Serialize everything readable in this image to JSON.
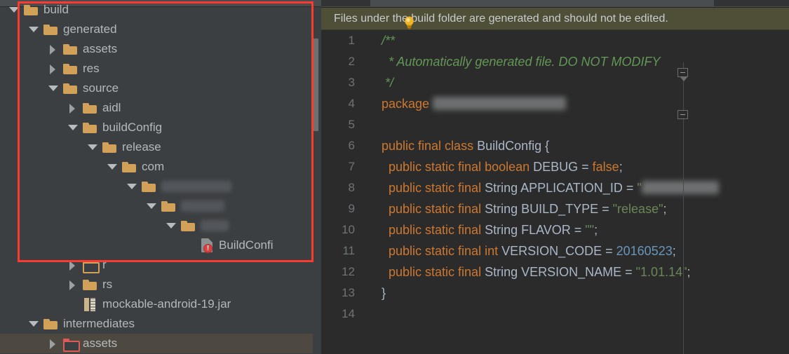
{
  "window": {
    "theme": "darcula",
    "accent_annotation_color": "#fb3b30",
    "panel_bg": "#3c3f41",
    "editor_bg": "#2b2b2b",
    "banner_bg": "#4f4f38",
    "selection_bg": "#4e4940"
  },
  "tree": {
    "panel_name": "Project tool window",
    "scroll_thumb_visible": true,
    "items": [
      {
        "label": "build",
        "depth": 0,
        "state": "expanded",
        "icon": "folder-icon",
        "selected": false,
        "redacted": false
      },
      {
        "label": "generated",
        "depth": 1,
        "state": "expanded",
        "icon": "folder-icon",
        "selected": false,
        "redacted": false
      },
      {
        "label": "assets",
        "depth": 2,
        "state": "collapsed",
        "icon": "folder-icon",
        "selected": false,
        "redacted": false
      },
      {
        "label": "res",
        "depth": 2,
        "state": "collapsed",
        "icon": "folder-icon",
        "selected": false,
        "redacted": false
      },
      {
        "label": "source",
        "depth": 2,
        "state": "expanded",
        "icon": "folder-icon",
        "selected": false,
        "redacted": false
      },
      {
        "label": "aidl",
        "depth": 3,
        "state": "collapsed",
        "icon": "folder-icon",
        "selected": false,
        "redacted": false
      },
      {
        "label": "buildConfig",
        "depth": 3,
        "state": "expanded",
        "icon": "folder-icon",
        "selected": false,
        "redacted": false
      },
      {
        "label": "release",
        "depth": 4,
        "state": "expanded",
        "icon": "folder-icon",
        "selected": false,
        "redacted": false
      },
      {
        "label": "com",
        "depth": 5,
        "state": "expanded",
        "icon": "folder-icon",
        "selected": false,
        "redacted": false
      },
      {
        "label": "",
        "depth": 6,
        "state": "expanded",
        "icon": "folder-icon",
        "selected": false,
        "redacted": true,
        "redact_width": 100
      },
      {
        "label": "",
        "depth": 7,
        "state": "expanded",
        "icon": "folder-icon",
        "selected": false,
        "redacted": true,
        "redact_width": 62
      },
      {
        "label": "",
        "depth": 8,
        "state": "expanded",
        "icon": "folder-icon",
        "selected": false,
        "redacted": true,
        "redact_width": 40
      },
      {
        "label": "BuildConfi",
        "depth": 9,
        "state": "none",
        "icon": "java-file-error-icon",
        "selected": false,
        "redacted": false
      },
      {
        "label": "r",
        "depth": 3,
        "state": "collapsed",
        "icon": "folder-open-icon",
        "selected": false,
        "redacted": false
      },
      {
        "label": "rs",
        "depth": 3,
        "state": "collapsed",
        "icon": "folder-icon",
        "selected": false,
        "redacted": false
      },
      {
        "label": "mockable-android-19.jar",
        "depth": 3,
        "state": "none",
        "icon": "jar-archive-icon",
        "selected": false,
        "redacted": false
      },
      {
        "label": "intermediates",
        "depth": 1,
        "state": "expanded",
        "icon": "folder-icon",
        "selected": false,
        "redacted": false
      },
      {
        "label": "assets",
        "depth": 2,
        "state": "collapsed",
        "icon": "folder-red-icon",
        "selected": true,
        "redacted": false
      }
    ]
  },
  "editor": {
    "banner": {
      "text": "Files under the build folder are generated and should not be edited.",
      "icon": "lightbulb-icon"
    },
    "line_numbers": [
      "1",
      "2",
      "3",
      "4",
      "5",
      "6",
      "7",
      "8",
      "9",
      "10",
      "11",
      "12",
      "13",
      "14"
    ],
    "lines": [
      {
        "n": "1",
        "fold": "start",
        "tokens": [
          {
            "t": "/**",
            "c": "cmt"
          }
        ]
      },
      {
        "n": "2",
        "fold": "",
        "tokens": [
          {
            "t": "  * Automatically generated file. DO NOT MODIFY",
            "c": "cmt"
          }
        ]
      },
      {
        "n": "3",
        "fold": "end",
        "tokens": [
          {
            "t": " */",
            "c": "cmt"
          }
        ]
      },
      {
        "n": "4",
        "fold": "",
        "tokens": [
          {
            "t": "package ",
            "c": "kw"
          },
          {
            "t": "",
            "c": "blurcode",
            "w": 190
          }
        ]
      },
      {
        "n": "5",
        "fold": "",
        "tokens": []
      },
      {
        "n": "6",
        "fold": "",
        "tokens": [
          {
            "t": "public final class ",
            "c": "kw"
          },
          {
            "t": "BuildConfig {",
            "c": "typ"
          }
        ]
      },
      {
        "n": "7",
        "fold": "",
        "tokens": [
          {
            "t": "  public static final boolean ",
            "c": "kw"
          },
          {
            "t": "DEBUG = ",
            "c": "typ"
          },
          {
            "t": "false",
            "c": "kw"
          },
          {
            "t": ";",
            "c": "typ"
          }
        ]
      },
      {
        "n": "8",
        "fold": "",
        "tokens": [
          {
            "t": "  public static final ",
            "c": "kw"
          },
          {
            "t": "String APPLICATION_ID = ",
            "c": "typ"
          },
          {
            "t": "\"",
            "c": "str"
          },
          {
            "t": "",
            "c": "blurcode",
            "w": 110
          }
        ]
      },
      {
        "n": "9",
        "fold": "",
        "tokens": [
          {
            "t": "  public static final ",
            "c": "kw"
          },
          {
            "t": "String BUILD_TYPE = ",
            "c": "typ"
          },
          {
            "t": "\"release\"",
            "c": "str"
          },
          {
            "t": ";",
            "c": "typ"
          }
        ]
      },
      {
        "n": "10",
        "fold": "",
        "tokens": [
          {
            "t": "  public static final ",
            "c": "kw"
          },
          {
            "t": "String FLAVOR = ",
            "c": "typ"
          },
          {
            "t": "\"\"",
            "c": "str"
          },
          {
            "t": ";",
            "c": "typ"
          }
        ]
      },
      {
        "n": "11",
        "fold": "",
        "tokens": [
          {
            "t": "  public static final int ",
            "c": "kw"
          },
          {
            "t": "VERSION_CODE = ",
            "c": "typ"
          },
          {
            "t": "20160523",
            "c": "num"
          },
          {
            "t": ";",
            "c": "typ"
          }
        ]
      },
      {
        "n": "12",
        "fold": "",
        "tokens": [
          {
            "t": "  public static final ",
            "c": "kw"
          },
          {
            "t": "String VERSION_NAME = ",
            "c": "typ"
          },
          {
            "t": "\"1.01.14\"",
            "c": "str"
          },
          {
            "t": ";",
            "c": "typ"
          }
        ]
      },
      {
        "n": "13",
        "fold": "",
        "tokens": [
          {
            "t": "}",
            "c": "typ"
          }
        ]
      },
      {
        "n": "14",
        "fold": "",
        "tokens": []
      }
    ]
  }
}
